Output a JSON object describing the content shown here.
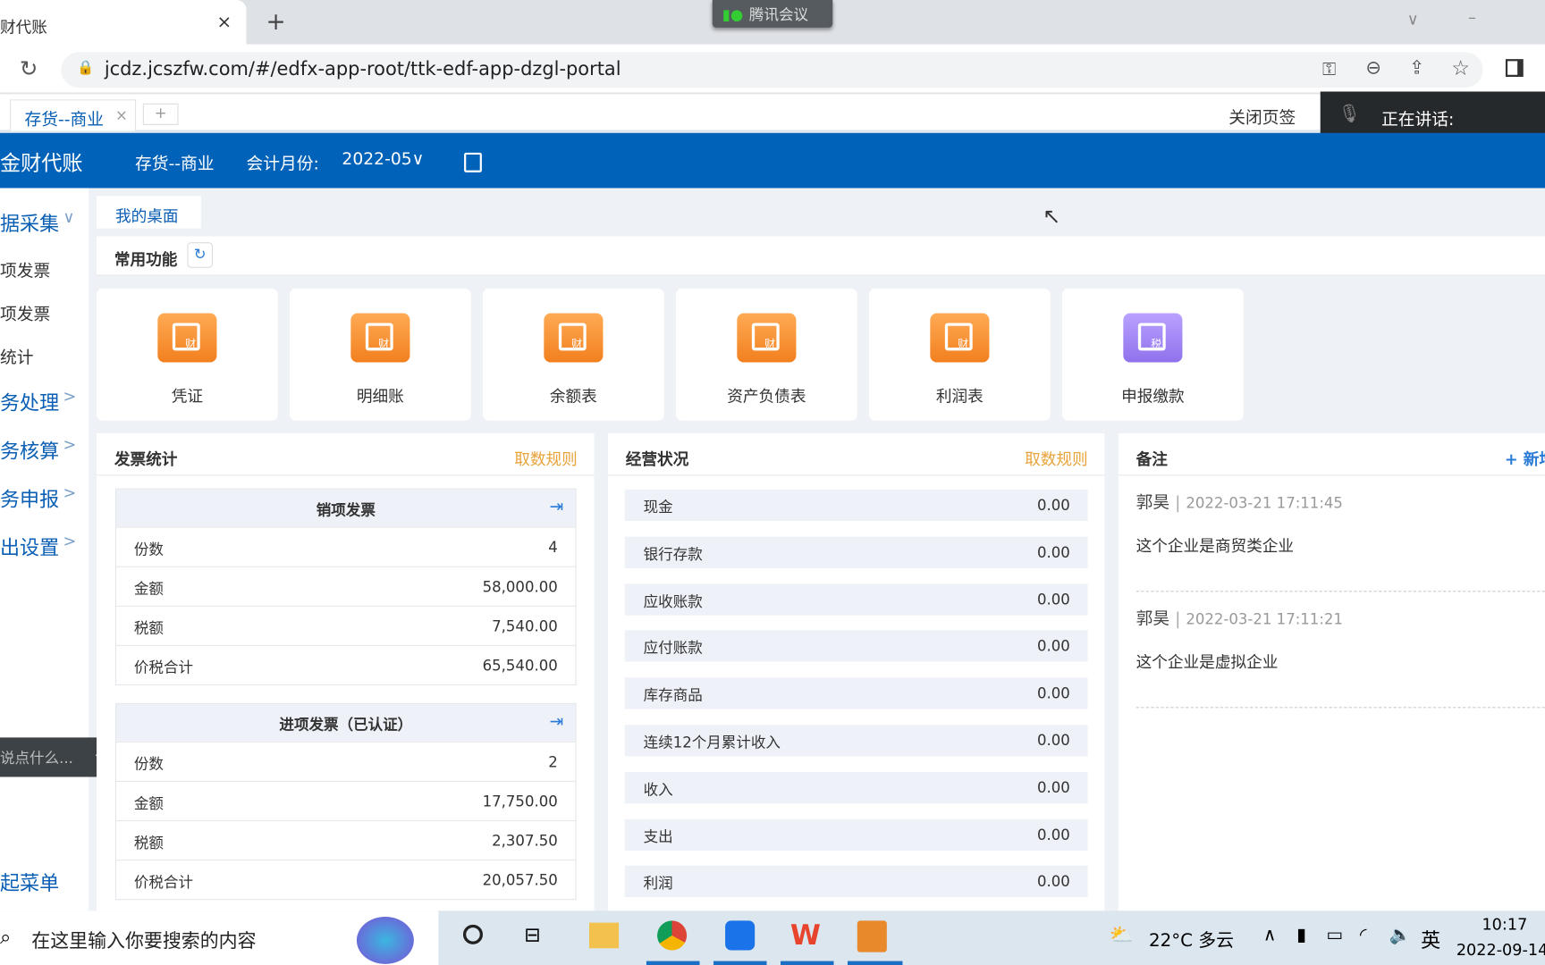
{
  "browser": {
    "tab_title": "财代账",
    "tab_close": "×",
    "new_tab": "+",
    "meeting": "腾讯会议",
    "url": "jcdz.jcszfw.com/#/edfx-app-root/ttk-edf-app-dzgl-portal"
  },
  "app_tabs": {
    "tab": "存货--商业",
    "close": "×",
    "add": "+",
    "close_tabs": "关闭页签",
    "speaking": "正在讲话:"
  },
  "header": {
    "logo": "金财代账",
    "company": "存货--商业",
    "period_label": "会计月份:",
    "period": "2022-05∨"
  },
  "sidebar": {
    "items": [
      {
        "label": "据采集",
        "chev": "∨",
        "group": true
      },
      {
        "label": "项发票"
      },
      {
        "label": "项发票"
      },
      {
        "label": "统计"
      },
      {
        "label": "务处理",
        "chev": ">",
        "group": true
      },
      {
        "label": "务核算",
        "chev": ">",
        "group": true
      },
      {
        "label": "务申报",
        "chev": ">",
        "group": true
      },
      {
        "label": "出设置",
        "chev": ">",
        "group": true
      }
    ],
    "chat": "说点什么...",
    "collapse": "起菜单"
  },
  "desk_tab": "我的桌面",
  "common": {
    "title": "常用功能",
    "cards": [
      {
        "label": "凭证",
        "glyph": "财"
      },
      {
        "label": "明细账",
        "glyph": "财"
      },
      {
        "label": "余额表",
        "glyph": "财"
      },
      {
        "label": "资产负债表",
        "glyph": "财"
      },
      {
        "label": "利润表",
        "glyph": "财"
      },
      {
        "label": "申报缴款",
        "glyph": "税"
      }
    ]
  },
  "invoice": {
    "title": "发票统计",
    "rule": "取数规则",
    "sales": {
      "title": "销项发票",
      "rows": [
        [
          "份数",
          "4"
        ],
        [
          "金额",
          "58,000.00"
        ],
        [
          "税额",
          "7,540.00"
        ],
        [
          "价税合计",
          "65,540.00"
        ]
      ]
    },
    "purchase": {
      "title": "进项发票（已认证）",
      "rows": [
        [
          "份数",
          "2"
        ],
        [
          "金额",
          "17,750.00"
        ],
        [
          "税额",
          "2,307.50"
        ],
        [
          "价税合计",
          "20,057.50"
        ]
      ]
    }
  },
  "business": {
    "title": "经营状况",
    "rule": "取数规则",
    "rows": [
      [
        "现金",
        "0.00"
      ],
      [
        "银行存款",
        "0.00"
      ],
      [
        "应收账款",
        "0.00"
      ],
      [
        "应付账款",
        "0.00"
      ],
      [
        "库存商品",
        "0.00"
      ],
      [
        "连续12个月累计收入",
        "0.00"
      ],
      [
        "收入",
        "0.00"
      ],
      [
        "支出",
        "0.00"
      ],
      [
        "利润",
        "0.00"
      ]
    ]
  },
  "notes": {
    "title": "备注",
    "add": "+ 新增",
    "items": [
      {
        "author": "郭昊",
        "time": "2022-03-21 17:11:45",
        "text": "这个企业是商贸类企业"
      },
      {
        "author": "郭昊",
        "time": "2022-03-21 17:11:21",
        "text": "这个企业是虚拟企业"
      }
    ]
  },
  "taskbar": {
    "search": "在这里输入你要搜索的内容",
    "weather": "22°C 多云",
    "ime": "英",
    "time": "10:17",
    "date": "2022-09-14"
  },
  "colors": {
    "header": "#0062b8",
    "accent_link": "#e8a33a",
    "card_orange": "#f2801e",
    "card_purple": "#8f72ec"
  }
}
